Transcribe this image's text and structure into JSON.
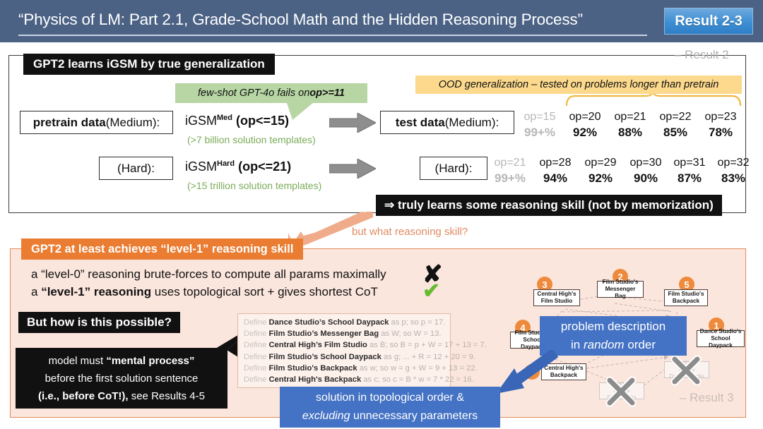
{
  "header": {
    "title": "“Physics of LM: Part 2.1, Grade-School Math and the Hidden Reasoning Process”",
    "badge": "Result 2-3",
    "badge_color": "#3d8fd4",
    "bar_color": "#4b6285"
  },
  "top_panel": {
    "heading": "GPT2 learns iGSM by true generalization",
    "corner_label": "– Result 2",
    "green_callout": {
      "prefix": "few-shot GPT-4o fails on ",
      "bold": "op>=11"
    },
    "orange_callout": "OOD generalization – tested on problems longer than pretrain",
    "rows": [
      {
        "left_label_bold": "pretrain data",
        "left_label_rest": " (Medium):",
        "dataset": "iGSM",
        "dataset_sup": "Med",
        "dataset_cond": "(op<=15)",
        "templates": "(>7 billion solution templates)",
        "right_label_bold": "test data",
        "right_label_rest": " (Medium):",
        "results": [
          {
            "op": "op=15",
            "acc": "99+%",
            "faded": true
          },
          {
            "op": "op=20",
            "acc": "92%",
            "faded": false
          },
          {
            "op": "op=21",
            "acc": "88%",
            "faded": false
          },
          {
            "op": "op=22",
            "acc": "85%",
            "faded": false
          },
          {
            "op": "op=23",
            "acc": "78%",
            "faded": false
          }
        ]
      },
      {
        "left_label_bold": "",
        "left_label_rest": "(Hard):",
        "dataset": "iGSM",
        "dataset_sup": "Hard",
        "dataset_cond": "(op<=21)",
        "templates": "(>15 trillion solution templates)",
        "right_label_bold": "",
        "right_label_rest": "(Hard):",
        "results": [
          {
            "op": "op=21",
            "acc": "99+%",
            "faded": true
          },
          {
            "op": "op=28",
            "acc": "94%",
            "faded": false
          },
          {
            "op": "op=29",
            "acc": "92%",
            "faded": false
          },
          {
            "op": "op=30",
            "acc": "90%",
            "faded": false
          },
          {
            "op": "op=31",
            "acc": "87%",
            "faded": false
          },
          {
            "op": "op=32",
            "acc": "83%",
            "faded": false
          }
        ]
      }
    ],
    "conclusion": "⇒ truly learns some reasoning skill (not by memorization)"
  },
  "transition": {
    "question": "but what reasoning skill?"
  },
  "bottom_panel": {
    "heading": "GPT2 at least achieves “level-1” reasoning skill",
    "corner_label": "– Result 3",
    "bullets": [
      {
        "pre": "a “level-0” reasoning",
        "post": " brute-forces to compute all params maximally",
        "mark": "✘"
      },
      {
        "pre": "a ",
        "bold": "“level-1” reasoning",
        "post": " uses topological sort + gives shortest CoT",
        "mark": "✔"
      }
    ],
    "how_box": "But how is this possible?",
    "model_box": {
      "line1_pre": "model must ",
      "line1_bold": "“mental process”",
      "line2": "before the first solution sentence",
      "line3_bold": "(i.e., before CoT!),",
      "line3_rest": " see Results 4-5"
    },
    "definitions": [
      {
        "kw": "Define",
        "name": "Dance Studio’s School Daypack",
        "tail": "as p; so p = 17."
      },
      {
        "kw": "Define",
        "name": "Film Studio’s Messenger Bag",
        "tail": "as W; so W = 13."
      },
      {
        "kw": "Define",
        "name": "Central High’s Film Studio",
        "tail": "as B; so B = p + W = 17 + 13 = 7."
      },
      {
        "kw": "Define",
        "name": "Film Studio’s School Daypack",
        "tail": "as g; ... + R = 12 + 20 = 9."
      },
      {
        "kw": "Define",
        "name": "Film Studio's Backpack",
        "tail": "as w; so w = g + W = 9 + 13 = 22."
      },
      {
        "kw": "Define",
        "name": "Central High's Backpack",
        "tail": "as c; so c = B * w = 7 * 22 = 16."
      }
    ],
    "solution_banner": {
      "line1": "solution in topological order &",
      "line2_italic": "excluding",
      "line2_rest": " unnecessary parameters"
    },
    "description_banner": {
      "line1": "problem description",
      "line2_pre": "in ",
      "line2_italic": "random",
      "line2_post": " order"
    },
    "graph": {
      "nodes": [
        {
          "id": 1,
          "label_line1": "Dance Studio's",
          "label_line2": "School Daypack",
          "order": "1",
          "dim": false
        },
        {
          "id": 2,
          "label_line1": "Film Studio's",
          "label_line2": "Messenger Bag",
          "order": "2",
          "dim": false
        },
        {
          "id": 3,
          "label_line1": "Central High's",
          "label_line2": "Film Studio",
          "order": "3",
          "dim": false
        },
        {
          "id": 4,
          "label_line1": "Film Studio's",
          "label_line2": "School Daypack",
          "order": "4",
          "dim": false
        },
        {
          "id": 5,
          "label_line1": "Film Studio's",
          "label_line2": "Backpack",
          "order": "5",
          "dim": false
        },
        {
          "id": 6,
          "label_line1": "Central High's",
          "label_line2": "Backpack",
          "order": "6",
          "dim": false
        },
        {
          "id": 7,
          "label_line1": "Riverview High's",
          "label_line2": "Dance Studio",
          "order": "",
          "dim": true
        },
        {
          "id": 8,
          "label_line1": "Riverview High's",
          "label_line2": "Film Studio",
          "order": "",
          "dim": true
        }
      ]
    }
  }
}
